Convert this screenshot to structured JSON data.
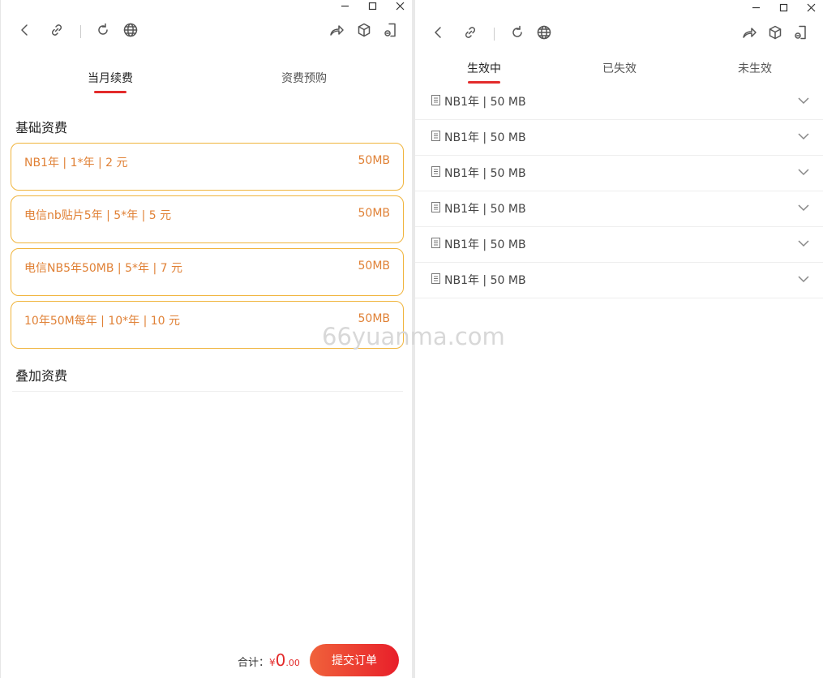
{
  "left": {
    "tabs": [
      {
        "label": "当月续费",
        "active": true
      },
      {
        "label": "资费预购",
        "active": false
      }
    ],
    "base_section": "基础资费",
    "plans": [
      {
        "name": "NB1年 | 1*年 | 2 元",
        "size": "50MB"
      },
      {
        "name": "电信nb贴片5年 | 5*年 | 5 元",
        "size": "50MB"
      },
      {
        "name": "电信NB5年50MB | 5*年 | 7 元",
        "size": "50MB"
      },
      {
        "name": "10年50M每年 | 10*年 | 10 元",
        "size": "50MB"
      }
    ],
    "addon_section": "叠加资费",
    "footer": {
      "total_label": "合计：",
      "currency": "¥",
      "amount_int": "0",
      "amount_dec": ".00",
      "submit_label": "提交订单"
    }
  },
  "right": {
    "tabs": [
      {
        "label": "生效中",
        "active": true
      },
      {
        "label": "已失效",
        "active": false
      },
      {
        "label": "未生效",
        "active": false
      }
    ],
    "rows": [
      {
        "label": "NB1年 | 50 MB"
      },
      {
        "label": "NB1年 | 50 MB"
      },
      {
        "label": "NB1年 | 50 MB"
      },
      {
        "label": "NB1年 | 50 MB"
      },
      {
        "label": "NB1年 | 50 MB"
      },
      {
        "label": "NB1年 | 50 MB"
      }
    ]
  },
  "watermark": "66yuanma.com",
  "colors": {
    "accent": "#e32b2b",
    "plan_border": "#f0b43c",
    "plan_text": "#e08136"
  },
  "icons": {
    "toolbar": [
      "back-icon",
      "link-icon",
      "refresh-icon",
      "globe-icon",
      "share-icon",
      "cube-icon",
      "phone-icon"
    ],
    "window": [
      "minimize-icon",
      "maximize-icon",
      "close-icon"
    ]
  }
}
